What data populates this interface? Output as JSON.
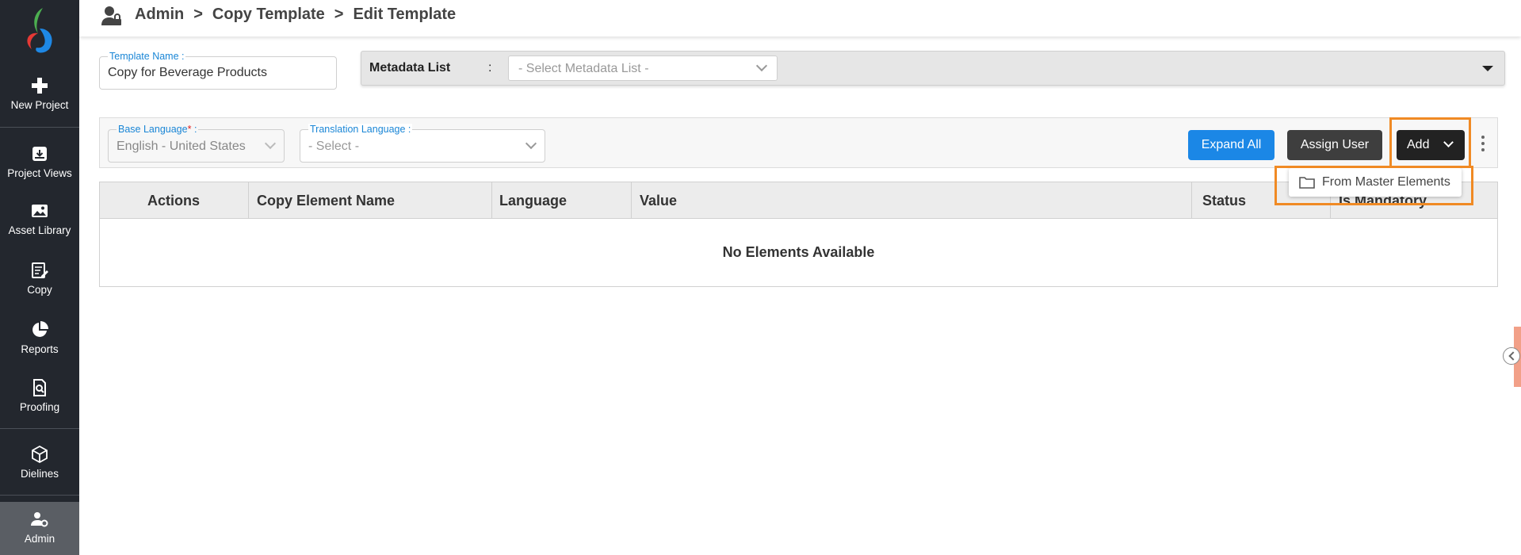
{
  "sidebar": {
    "items": [
      {
        "label": "New Project",
        "icon": "plus-icon"
      },
      {
        "label": "Project Views",
        "icon": "project-views-icon"
      },
      {
        "label": "Asset Library",
        "icon": "image-icon"
      },
      {
        "label": "Copy",
        "icon": "edit-document-icon"
      },
      {
        "label": "Reports",
        "icon": "pie-chart-icon"
      },
      {
        "label": "Proofing",
        "icon": "document-search-icon"
      },
      {
        "label": "Dielines",
        "icon": "box-icon"
      },
      {
        "label": "Admin",
        "icon": "user-gear-icon"
      }
    ]
  },
  "header": {
    "crumbs": [
      "Admin",
      "Copy Template",
      "Edit Template"
    ],
    "separator": ">"
  },
  "template_name": {
    "legend": "Template Name :",
    "value": "Copy for Beverage Products"
  },
  "metadata": {
    "label": "Metadata List",
    "colon": ":",
    "placeholder": "- Select Metadata List -"
  },
  "base_language": {
    "legend": "Base Language",
    "required": "*",
    "suffix": ":",
    "value": "English - United States"
  },
  "translation_language": {
    "legend": "Translation Language :",
    "value": "- Select -"
  },
  "buttons": {
    "expand_all": "Expand All",
    "assign_user": "Assign User",
    "add": "Add"
  },
  "dropdown": {
    "item": "From Master Elements"
  },
  "table": {
    "columns": [
      "Actions",
      "Copy Element Name",
      "Language",
      "Value",
      "Status",
      "Is Mandatory"
    ],
    "empty_text": "No Elements Available"
  },
  "colors": {
    "sidebar": "#23272e",
    "accent": "#1b87e6",
    "highlight": "#f08a24",
    "legend": "#1a86d6"
  }
}
